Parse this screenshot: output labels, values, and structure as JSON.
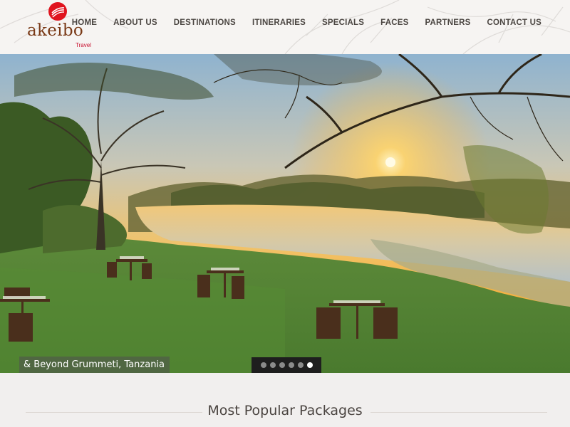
{
  "brand": {
    "name": "akeibo",
    "subtitle": "Travel",
    "mark_color": "#e0141e"
  },
  "nav": {
    "items": [
      {
        "label": "HOME"
      },
      {
        "label": "ABOUT US"
      },
      {
        "label": "DESTINATIONS"
      },
      {
        "label": "ITINERARIES"
      },
      {
        "label": "SPECIALS"
      },
      {
        "label": "FACES"
      },
      {
        "label": "PARTNERS"
      },
      {
        "label": "CONTACT US"
      }
    ]
  },
  "hero": {
    "caption": "& Beyond Grummeti, Tanzania",
    "slide_count": 6,
    "active_slide": 6
  },
  "packages": {
    "title": "Most Popular Packages"
  },
  "colors": {
    "nav_text": "#4b4642",
    "brand_brown": "#7a3a17",
    "accent_red": "#c8102e",
    "page_bg": "#f1efee"
  }
}
